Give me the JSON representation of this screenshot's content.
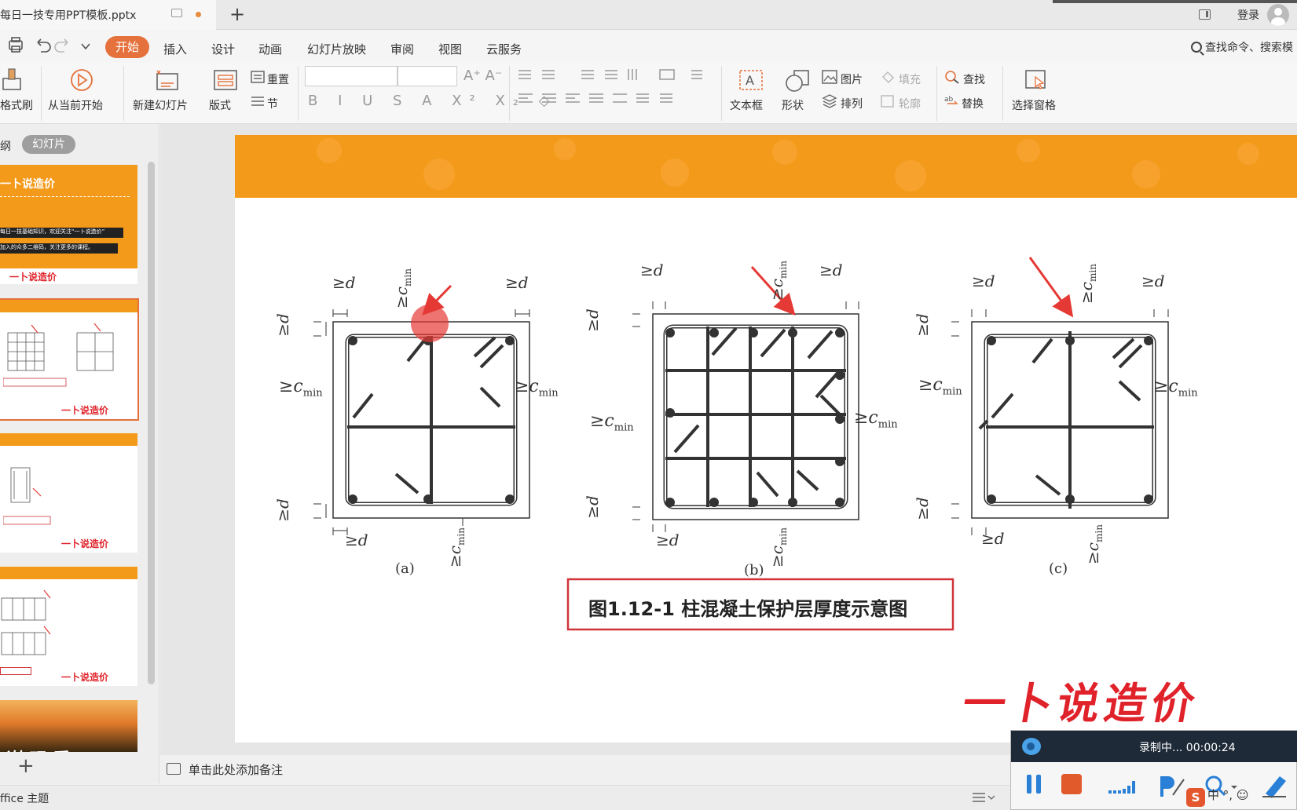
{
  "titlebar": {
    "doc_name": "每日一技专用PPT模板.pptx",
    "new_tab": "+",
    "login": "登录"
  },
  "menubar": {
    "items": [
      "开始",
      "插入",
      "设计",
      "动画",
      "幻灯片放映",
      "审阅",
      "视图",
      "云服务"
    ],
    "search": "查找命令、搜索模"
  },
  "ribbon": {
    "format_painter": "格式刷",
    "from_current": "从当前开始",
    "new_slide": "新建幻灯片",
    "layout": "版式",
    "reset": "重置",
    "section": "节",
    "text_box": "文本框",
    "shape": "形状",
    "picture": "图片",
    "arrange": "排列",
    "fill": "填充",
    "outline": "轮廓",
    "find": "查找",
    "replace": "替换",
    "select_pane": "选择窗格"
  },
  "left_panel": {
    "tab_outline": "纲",
    "tab_slides": "幻灯片",
    "thumb1_title": "一卜说造价",
    "thumb1_line1": "每日一技基础知识，欢迎关注“一卜说造价”",
    "thumb1_line2": "加入的众多二维码，关注更多的课程。",
    "thumb_logo": "一卜说造价",
    "thumb5_text": "谢 观 看",
    "add_slide": "+"
  },
  "slide": {
    "caption": "图1.12-1 柱混凝土保护层厚度示意图",
    "labels": {
      "a": "(a)",
      "b": "(b)",
      "c": "(c)",
      "d": "≥d",
      "cmin": "≥c",
      "sub_min": "min"
    },
    "watermark": "一卜说造价"
  },
  "notes": {
    "placeholder": "单击此处添加备注"
  },
  "statusbar": {
    "theme": "ffice 主题"
  },
  "recorder": {
    "status": "录制中... 00:00:24"
  },
  "ime": {
    "mode": "中"
  },
  "colors": {
    "accent": "#e5723c",
    "banner": "#f49a1a",
    "caption_border": "#d0343a",
    "arrow": "#e53935",
    "watermark": "#e0222a"
  }
}
